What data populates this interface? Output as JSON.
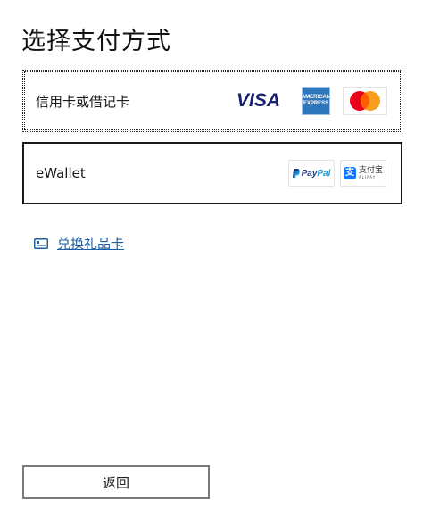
{
  "page": {
    "title": "选择支付方式"
  },
  "payment_options": [
    {
      "label": "信用卡或借记卡",
      "logos": [
        {
          "icon": "visa-logo",
          "text": "VISA"
        },
        {
          "icon": "amex-logo",
          "text_line1": "AMERICAN",
          "text_line2": "EXPRESS"
        },
        {
          "icon": "mastercard-logo"
        }
      ]
    },
    {
      "label": "eWallet",
      "logos": [
        {
          "icon": "paypal-logo",
          "text_pay": "Pay",
          "text_pal": "Pal"
        },
        {
          "icon": "alipay-logo",
          "text_cn": "支付宝",
          "text_en": "ALIPAY"
        }
      ]
    }
  ],
  "giftcard": {
    "icon": "gift-card-icon",
    "label": "兑换礼品卡"
  },
  "footer": {
    "back_label": "返回"
  },
  "colors": {
    "link": "#1a5fa8",
    "visa": "#1a1f71",
    "amex": "#2e77bc",
    "mastercard_red": "#eb001b",
    "mastercard_yellow": "#f79e1b",
    "paypal_dark": "#253b80",
    "paypal_light": "#179bd7",
    "alipay": "#1677ff"
  }
}
